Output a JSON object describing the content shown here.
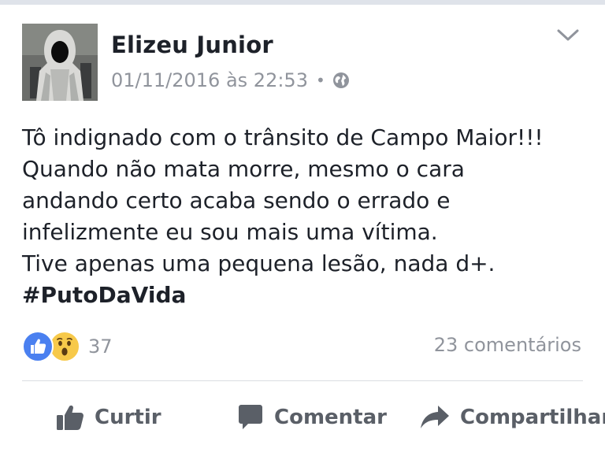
{
  "post": {
    "author": "Elizeu Junior",
    "timestamp": "01/11/2016 às 22:53",
    "separator": "•",
    "privacy_icon": "globe-icon",
    "menu_icon": "chevron-down-icon",
    "text_lines": [
      "Tô indignado com o trânsito de Campo Maior!!!",
      "Quando não mata morre, mesmo o cara",
      "andando certo acaba sendo o errado e",
      "infelizmente eu sou mais uma vítima.",
      "Tive apenas uma pequena lesão, nada d+."
    ],
    "hashtag": "#PutoDaVida"
  },
  "reactions": {
    "icons": [
      "like-reaction-icon",
      "wow-reaction-icon"
    ],
    "count": "37",
    "comments_label": "23 comentários"
  },
  "actions": {
    "like": "Curtir",
    "comment": "Comentar",
    "share": "Compartilhar"
  },
  "colors": {
    "text": "#1d2129",
    "muted": "#90949c",
    "action": "#5a5f67",
    "like_blue": "#4a80f0",
    "wow_yellow": "#f7c94a"
  }
}
